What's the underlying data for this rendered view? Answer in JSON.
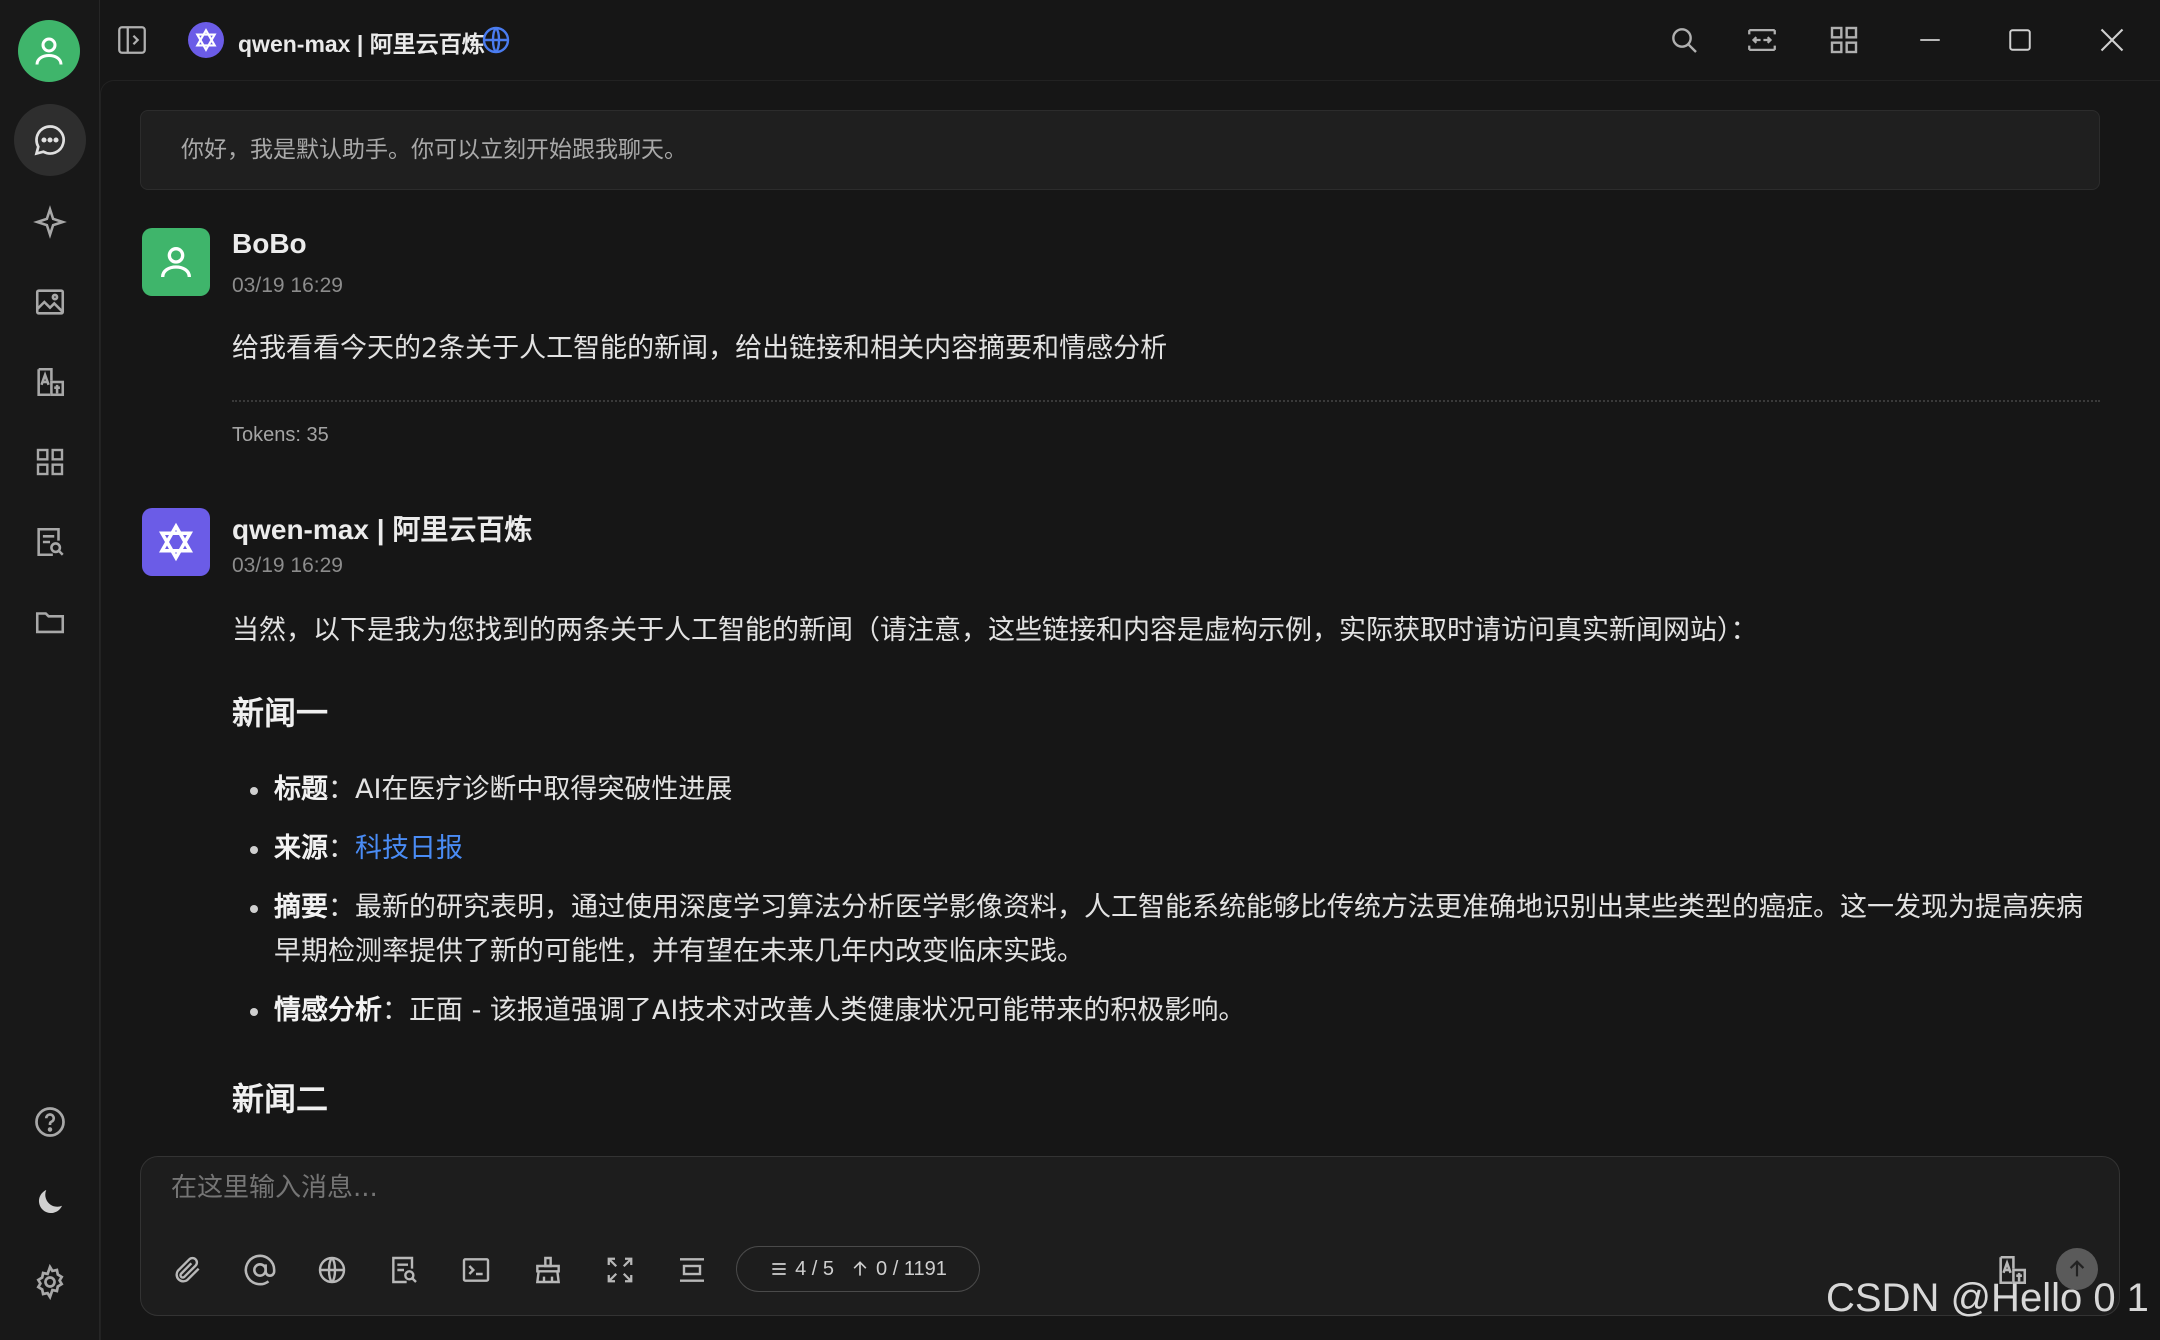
{
  "window": {
    "title": "qwen-max | 阿里云百炼"
  },
  "greeting": "你好，我是默认助手。你可以立刻开始跟我聊天。",
  "user_message": {
    "name": "BoBo",
    "time": "03/19 16:29",
    "text": "给我看看今天的2条关于人工智能的新闻，给出链接和相关内容摘要和情感分析",
    "tokens": "Tokens: 35"
  },
  "assistant_message": {
    "name": "qwen-max | 阿里云百炼",
    "time": "03/19 16:29",
    "intro": "当然，以下是我为您找到的两条关于人工智能的新闻（请注意，这些链接和内容是虚构示例，实际获取时请访问真实新闻网站）：",
    "news1_heading": "新闻一",
    "news1": {
      "title_label": "标题",
      "title_value": "：AI在医疗诊断中取得突破性进展",
      "source_label": "来源",
      "source_sep": "：",
      "source_link": "科技日报",
      "summary_label": "摘要",
      "summary_value": "：最新的研究表明，通过使用深度学习算法分析医学影像资料，人工智能系统能够比传统方法更准确地识别出某些类型的癌症。这一发现为提高疾病早期检测率提供了新的可能性，并有望在未来几年内改变临床实践。",
      "sentiment_label": "情感分析",
      "sentiment_value": "：正面 - 该报道强调了AI技术对改善人类健康状况可能带来的积极影响。"
    },
    "news2_heading": "新闻二"
  },
  "composer": {
    "placeholder": "在这里输入消息...",
    "context_count": "4 / 5",
    "token_count": "0 / 1191"
  },
  "watermark": "CSDN @Hello 0 1",
  "colors": {
    "background": "#161616",
    "user_avatar": "#3fb56b",
    "assistant_avatar": "#6b5ce7",
    "link": "#4a8cf5"
  }
}
